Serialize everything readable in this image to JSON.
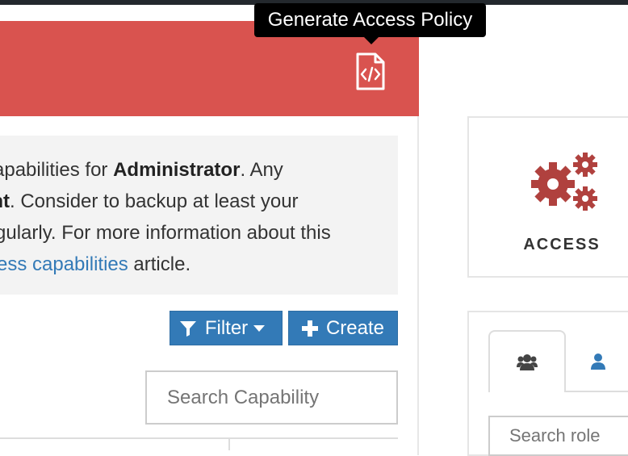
{
  "tooltip": {
    "text": "Generate Access Policy"
  },
  "header": {
    "policy_icon": "code-file-icon"
  },
  "notice": {
    "line1_pre": "apabilities for ",
    "line1_bold": "Administrator",
    "line1_post": ". Any",
    "line2_bold": "ent",
    "line2_post": ". Consider to backup at least your",
    "line3": "gularly. For more information about this",
    "line4_link": "ess capabilities",
    "line4_post": " article."
  },
  "toolbar": {
    "filter_label": "Filter",
    "create_label": "Create",
    "filter_icon": "filter-icon",
    "create_icon": "plus-icon"
  },
  "search": {
    "placeholder": "Search Capability"
  },
  "access_widget": {
    "label": "ACCESS",
    "icon": "gears-icon"
  },
  "roles_panel": {
    "tabs": [
      {
        "icon": "users-icon"
      },
      {
        "icon": "user-icon"
      }
    ],
    "search_placeholder": "Search role"
  },
  "colors": {
    "header_red": "#d9534f",
    "primary_blue": "#337ab7",
    "gear_red": "#b0413e",
    "link_blue": "#337ab7"
  }
}
